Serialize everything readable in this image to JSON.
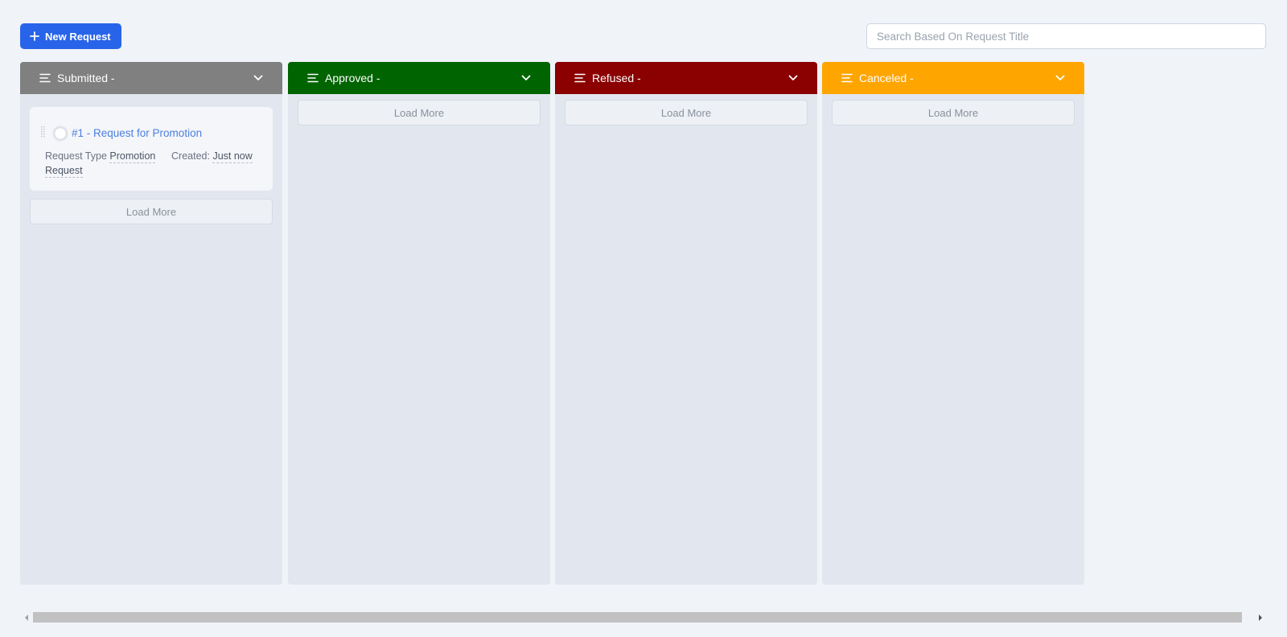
{
  "toolbar": {
    "new_request_label": "New Request",
    "search_placeholder": "Search Based On Request Title"
  },
  "columns": [
    {
      "title": "Submitted -",
      "color": "#808080",
      "load_more": "Load More",
      "cards": [
        {
          "title": "#1 - Request for Promotion",
          "request_type_label": "Request Type",
          "request_type_value_1": "Promotion",
          "request_type_value_2": "Request",
          "created_label": "Created:",
          "created_value": "Just now"
        }
      ]
    },
    {
      "title": "Approved -",
      "color": "#006400",
      "load_more": "Load More",
      "cards": []
    },
    {
      "title": "Refused -",
      "color": "#8b0000",
      "load_more": "Load More",
      "cards": []
    },
    {
      "title": "Canceled -",
      "color": "#ffa500",
      "load_more": "Load More",
      "cards": []
    }
  ],
  "colors": {
    "accent": "#2864ea",
    "card_link": "#4b7fe0"
  },
  "icons": [
    "plus-icon",
    "menu-lines-icon",
    "chevron-down-icon",
    "drag-handle-icon",
    "avatar-icon",
    "scroll-left-icon",
    "scroll-right-icon"
  ]
}
